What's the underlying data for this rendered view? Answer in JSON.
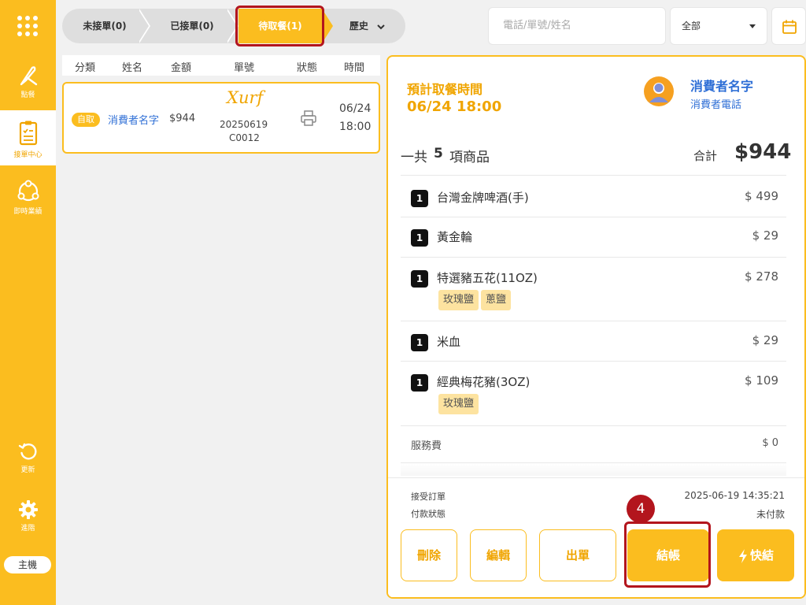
{
  "sidebar": {
    "items": [
      {
        "label": "點餐",
        "icon": "knife-icon"
      },
      {
        "label": "接單中心",
        "icon": "clipboard-icon"
      },
      {
        "label": "即時業績",
        "icon": "chart-cycle-icon"
      }
    ],
    "bottom": [
      {
        "label": "更新",
        "icon": "refresh-icon"
      },
      {
        "label": "進階",
        "icon": "gear-icon"
      }
    ],
    "host_label": "主機"
  },
  "tabs": {
    "items": [
      "未接單(0)",
      "已接單(0)",
      "待取餐(1)",
      "歷史"
    ],
    "active_index": 2
  },
  "search": {
    "placeholder": "電話/單號/姓名",
    "value": ""
  },
  "filter": {
    "selected": "全部"
  },
  "list": {
    "columns": [
      "分類",
      "姓名",
      "金額",
      "單號",
      "狀態",
      "時間"
    ],
    "orders": [
      {
        "tag": "自取",
        "name": "消費者名字",
        "amount": "$944",
        "logo_text": "Xurf",
        "order_no_line1": "20250619",
        "order_no_line2": "C0012",
        "date": "06/24",
        "time": "18:00"
      }
    ]
  },
  "detail": {
    "pickup_label": "預計取餐時間",
    "pickup_time": "06/24 18:00",
    "customer_name": "消費者名字",
    "customer_phone": "消費者電話",
    "count_prefix": "一共",
    "count_value": "5",
    "count_suffix": "項商品",
    "total_label": "合計",
    "total_value": "$944",
    "items": [
      {
        "qty": "1",
        "name": "台灣金牌啤酒(手)",
        "price": "$ 499",
        "mods": []
      },
      {
        "qty": "1",
        "name": "黃金輪",
        "price": "$ 29",
        "mods": []
      },
      {
        "qty": "1",
        "name": "特選豬五花(11OZ)",
        "price": "$ 278",
        "mods": [
          "玫瑰鹽",
          "蔥鹽"
        ]
      },
      {
        "qty": "1",
        "name": "米血",
        "price": "$ 29",
        "mods": []
      },
      {
        "qty": "1",
        "name": "經典梅花豬(3OZ)",
        "price": "$ 109",
        "mods": [
          "玫瑰鹽"
        ]
      }
    ],
    "service_fee_label": "服務費",
    "service_fee_value": "$ 0",
    "accept_label": "接受訂單",
    "accept_value": "2025-06-19 14:35:21",
    "payment_label": "付款狀態",
    "payment_value": "未付款",
    "actions": [
      "刪除",
      "編輯",
      "出單",
      "結帳",
      "快結"
    ]
  },
  "annotation": {
    "step": "4"
  },
  "colors": {
    "accent": "#fbbd1f",
    "accent_text": "#f0a500",
    "link": "#2f6fd6",
    "highlight": "#b3151d"
  }
}
